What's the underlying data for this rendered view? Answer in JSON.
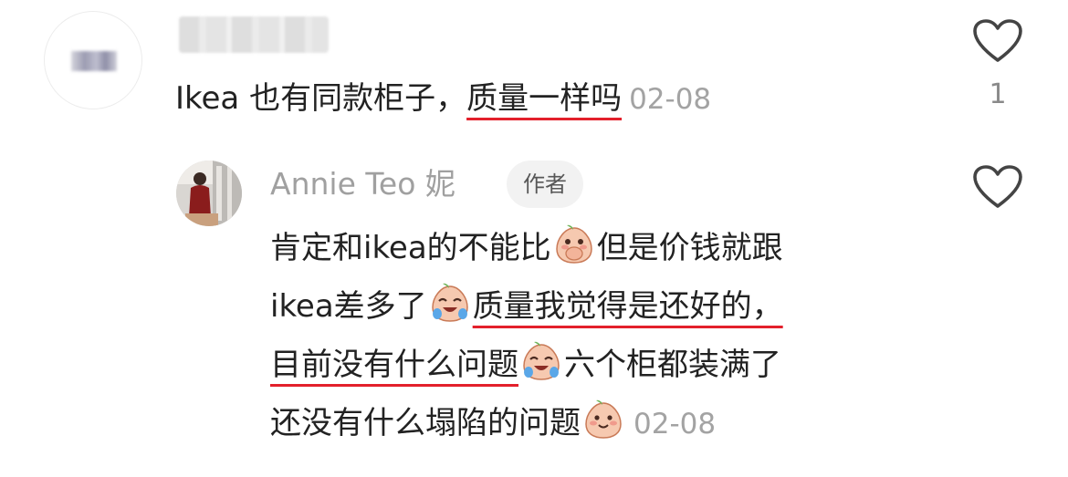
{
  "comment": {
    "text_plain": "Ikea 也有同款柜子，",
    "text_highlight": "质量一样吗",
    "date": "02-08",
    "like_count": "1"
  },
  "reply": {
    "author_name": "Annie Teo 妮",
    "author_badge": "作者",
    "line1_a": "肯定和ikea的不能比",
    "line1_b": "但是价钱就跟",
    "line2_a": "ikea差多了",
    "line2_highlight": "质量我觉得是还好的，",
    "line3_highlight": "目前没有什么问题",
    "line3_b": "六个柜都装满了",
    "line4_a": "还没有什么塌陷的问题",
    "date": "02-08"
  },
  "icons": {
    "like": "heart-outline-icon",
    "emoji_1": "covering-mouth-emoji",
    "emoji_2": "crying-laughing-emoji",
    "emoji_3": "crying-laughing-emoji",
    "emoji_4": "smiling-emoji"
  },
  "colors": {
    "highlight_underline": "#e3202b",
    "meta_text": "#a3a3a3",
    "badge_bg": "#f2f2f2"
  }
}
